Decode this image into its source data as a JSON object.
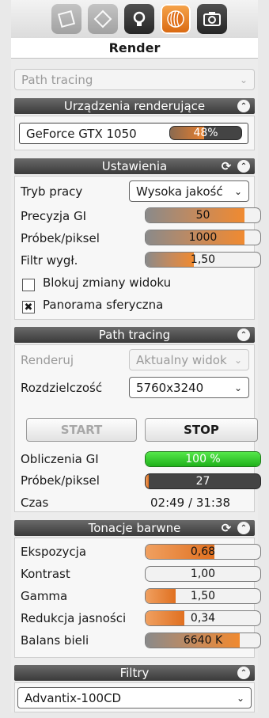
{
  "tabs": [
    {
      "name": "materials-tab-icon",
      "state": "inactive"
    },
    {
      "name": "scene-tab-icon",
      "state": "inactive"
    },
    {
      "name": "light-tab-icon",
      "state": "dark"
    },
    {
      "name": "render-tab-icon",
      "state": "active"
    },
    {
      "name": "camera-tab-icon",
      "state": "dark"
    }
  ],
  "title": "Render",
  "mode_select": {
    "value": "Path tracing"
  },
  "devices": {
    "header": "Urządzenia renderujące",
    "gpu_name": "GeForce GTX 1050",
    "gpu_usage_label": "48%",
    "gpu_usage": 0.48
  },
  "settings": {
    "header": "Ustawienia",
    "mode_label": "Tryb pracy",
    "mode_value": "Wysoka jakość",
    "gi_precision_label": "Precyzja GI",
    "gi_precision_value": "50",
    "gi_precision_fill": 0.86,
    "samples_label": "Próbek/piksel",
    "samples_value": "1000",
    "samples_fill": 0.86,
    "filter_label": "Filtr wygł.",
    "filter_value": "1,50",
    "filter_fill": 0.42,
    "lock_view_label": "Blokuj zmiany widoku",
    "lock_view_checked": false,
    "panorama_label": "Panorama sferyczna",
    "panorama_checked": true
  },
  "path_tracing": {
    "header": "Path tracing",
    "render_label": "Renderuj",
    "render_value": "Aktualny widok",
    "resolution_label": "Rozdzielczość",
    "resolution_value": "5760x3240",
    "start_label": "START",
    "stop_label": "STOP",
    "gi_calc_label": "Obliczenia GI",
    "gi_calc_value": "100 %",
    "gi_calc_fill": 1.0,
    "samples_label": "Próbek/piksel",
    "samples_value": "27",
    "samples_fill": 0.027,
    "time_label": "Czas",
    "time_value": "02:49 / 31:38"
  },
  "tone": {
    "header": "Tonacje barwne",
    "exposure_label": "Ekspozycja",
    "exposure_value": "0,68",
    "exposure_fill": 0.6,
    "contrast_label": "Kontrast",
    "contrast_value": "1,00",
    "contrast_fill": 0.0,
    "gamma_label": "Gamma",
    "gamma_value": "1,50",
    "gamma_fill": 0.26,
    "highlight_label": "Redukcja jasności",
    "highlight_value": "0,34",
    "highlight_fill": 0.34,
    "wb_label": "Balans bieli",
    "wb_value": "6640 K",
    "wb_fill": 0.82
  },
  "filters": {
    "header": "Filtry",
    "value": "Advantix-100CD"
  }
}
